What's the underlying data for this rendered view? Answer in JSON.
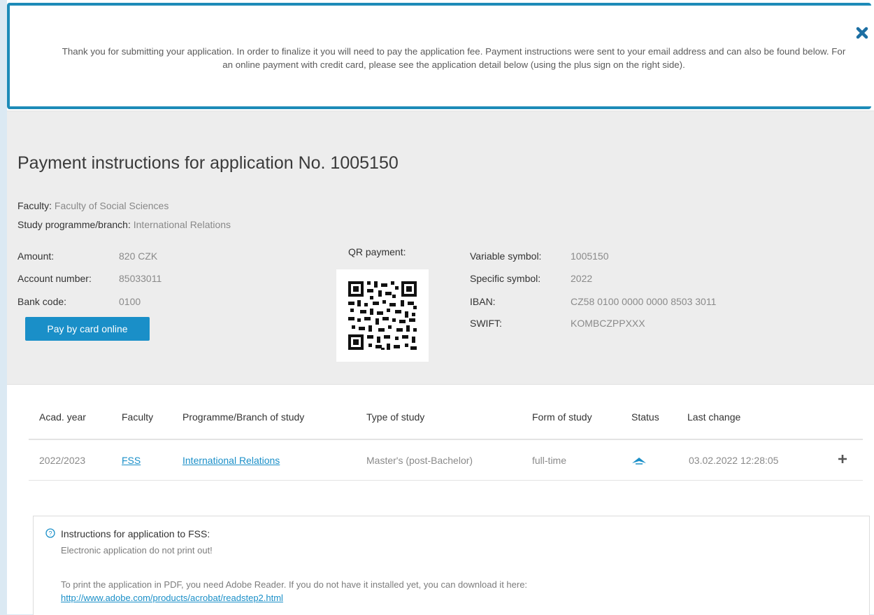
{
  "alert": {
    "message": "Thank you for submitting your application. In order to finalize it you will need to pay the application fee. Payment instructions were sent to your email address and can also be found below. For an online payment with credit card, please see the application detail below (using the plus sign on the right side).",
    "close_icon": "close-icon",
    "accent_color": "#1d8bb8"
  },
  "payment": {
    "title": "Payment instructions for application No. 1005150",
    "faculty_label": "Faculty:",
    "faculty_value": "Faculty of Social Sciences",
    "programme_label": "Study programme/branch:",
    "programme_value": "International Relations",
    "amount_label": "Amount:",
    "amount_value": "820 CZK",
    "account_label": "Account number:",
    "account_value": "85033011",
    "bank_label": "Bank code:",
    "bank_value": "0100",
    "pay_button": "Pay by card online",
    "qr_label": "QR payment:",
    "variable_label": "Variable symbol:",
    "variable_value": "1005150",
    "specific_label": "Specific symbol:",
    "specific_value": "2022",
    "iban_label": "IBAN:",
    "iban_value": "CZ58 0100 0000 0000 8503 3011",
    "swift_label": "SWIFT:",
    "swift_value": "KOMBCZPPXXX",
    "button_color": "#1a8fc8"
  },
  "table": {
    "headers": [
      "Acad. year",
      "Faculty",
      "Programme/Branch of study",
      "Type of study",
      "Form of study",
      "Status",
      "Last change"
    ],
    "rows": [
      {
        "acad_year": "2022/2023",
        "faculty": "FSS",
        "programme": "International Relations",
        "type": "Master's (post-Bachelor)",
        "form": "full-time",
        "status_icon": "plane-icon",
        "last_change": "03.02.2022 12:28:05",
        "expand_icon": "plus-icon"
      }
    ]
  },
  "info": {
    "icon": "question-circle-icon",
    "title": "Instructions for application to FSS:",
    "line1": "Electronic application do not print out!",
    "line2": "To print the application in PDF, you need Adobe Reader. If you do not have it installed yet, you can download it here:",
    "link": "http://www.adobe.com/products/acrobat/readstep2.html"
  }
}
